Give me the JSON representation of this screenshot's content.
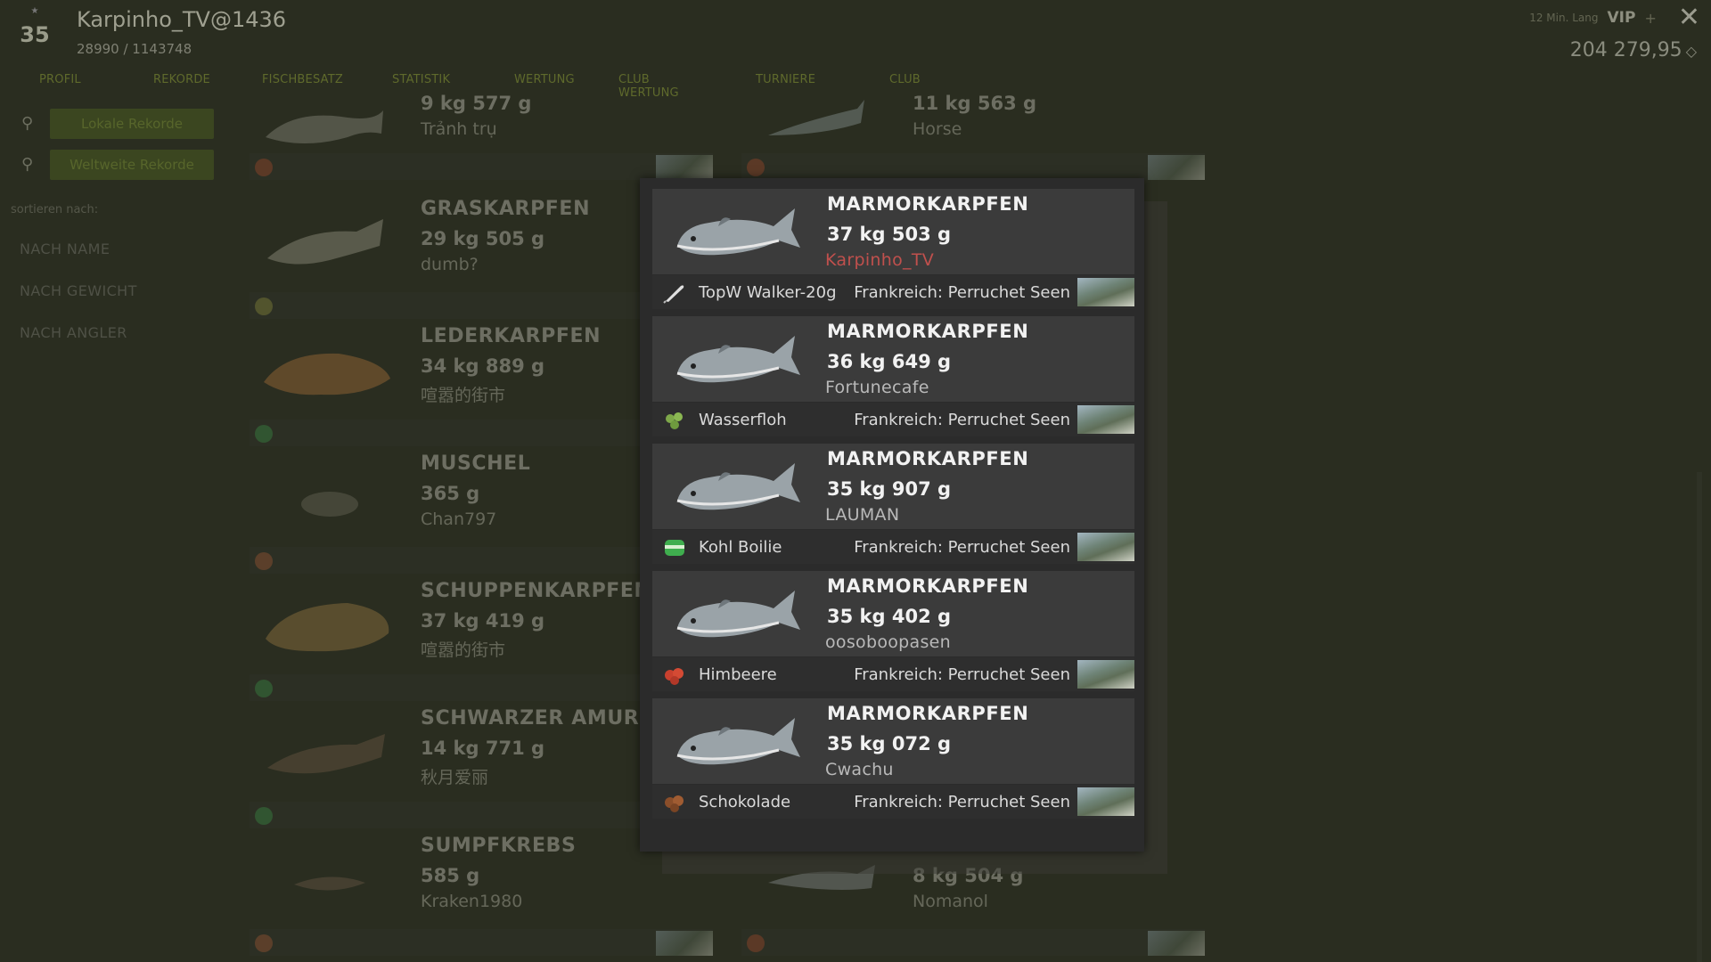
{
  "header": {
    "level": "35",
    "player_name": "Karpinho_TV@1436",
    "xp": "28990 / 1143748",
    "vip_sub": "12 Min. Lang",
    "vip": "VIP",
    "vip_plus": "+",
    "money": "204 279,95",
    "money_icon": "◇",
    "close": "✕"
  },
  "nav": {
    "tabs": [
      "PROFIL",
      "REKORDE",
      "FISCHBESATZ",
      "STATISTIK",
      "WERTUNG",
      "CLUB WERTUNG",
      "TURNIERE",
      "CLUB"
    ]
  },
  "sidebar": {
    "buttons": [
      "Lokale Rekorde",
      "Weltweite Rekorde"
    ],
    "sort_label": "sortieren nach:",
    "sort_options": [
      "NACH NAME",
      "NACH GEWICHT",
      "NACH ANGLER"
    ]
  },
  "background_records": [
    {
      "species": "",
      "weight": "9 kg 577 g",
      "angler": "Trảnh trụ"
    },
    {
      "species": "",
      "weight": "11 kg 563 g",
      "angler": "Horse"
    },
    {
      "species": "GRASKARPFEN",
      "weight": "29 kg 505 g",
      "angler": "dumb?"
    },
    {
      "species": "LEDERKARPFEN",
      "weight": "34 kg 889 g",
      "angler": "喧嚣的街市"
    },
    {
      "species": "MUSCHEL",
      "weight": "365 g",
      "angler": "Chan797"
    },
    {
      "species": "SCHUPPENKARPFEN",
      "weight": "37 kg 419 g",
      "angler": "喧嚣的街市"
    },
    {
      "species": "SCHWARZER AMUR",
      "weight": "14 kg 771 g",
      "angler": "秋月爱丽"
    },
    {
      "species": "SUMPFKREBS",
      "weight": "585 g",
      "angler": "Kraken1980"
    },
    {
      "species": "",
      "weight": "8 kg 504 g",
      "angler": "Nomanol"
    }
  ],
  "records": [
    {
      "species": "MARMORKARPFEN",
      "weight": "37 kg 503 g",
      "angler": "Karpinho_TV",
      "is_self": true,
      "bait": "TopW Walker-20g",
      "bait_icon": "lure-icon",
      "location": "Frankreich: Perruchet Seen"
    },
    {
      "species": "MARMORKARPFEN",
      "weight": "36 kg 649 g",
      "angler": "Fortunecafe",
      "is_self": false,
      "bait": "Wasserfloh",
      "bait_icon": "water-flea-icon",
      "location": "Frankreich: Perruchet Seen"
    },
    {
      "species": "MARMORKARPFEN",
      "weight": "35 kg 907 g",
      "angler": "LAUMAN",
      "is_self": false,
      "bait": "Kohl Boilie",
      "bait_icon": "boilie-jar-icon",
      "location": "Frankreich: Perruchet Seen"
    },
    {
      "species": "MARMORKARPFEN",
      "weight": "35 kg 402 g",
      "angler": "oosoboopasen",
      "is_self": false,
      "bait": "Himbeere",
      "bait_icon": "raspberry-icon",
      "location": "Frankreich: Perruchet Seen"
    },
    {
      "species": "MARMORKARPFEN",
      "weight": "35 kg 072 g",
      "angler": "Cwachu",
      "is_self": false,
      "bait": "Schokolade",
      "bait_icon": "chocolate-pellet-icon",
      "location": "Frankreich: Perruchet Seen"
    }
  ],
  "colors": {
    "self_angler": "#c0504d",
    "nav_accent": "#5f6a2c"
  }
}
